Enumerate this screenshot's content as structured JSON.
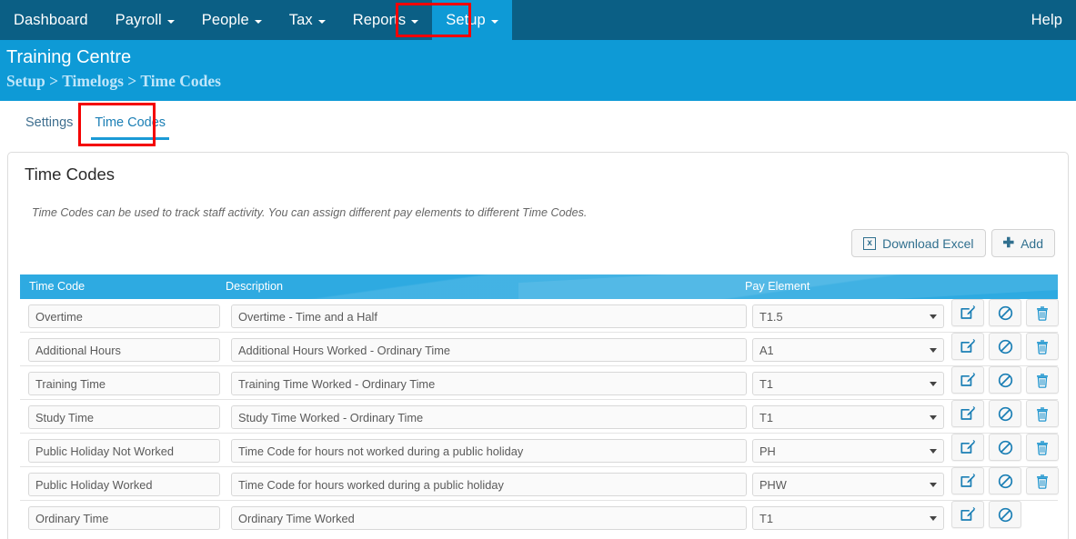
{
  "topnav": {
    "items": [
      {
        "label": "Dashboard",
        "caret": false,
        "active": false
      },
      {
        "label": "Payroll",
        "caret": true,
        "active": false
      },
      {
        "label": "People",
        "caret": true,
        "active": false
      },
      {
        "label": "Tax",
        "caret": true,
        "active": false
      },
      {
        "label": "Reports",
        "caret": true,
        "active": false
      },
      {
        "label": "Setup",
        "caret": true,
        "active": true
      }
    ],
    "help_label": "Help",
    "bg_color": "#0b5f85",
    "active_color": "#0e9ad6"
  },
  "page_header": {
    "org_title": "Training Centre",
    "breadcrumb": "Setup > Timelogs > Time Codes",
    "bg_color": "#0e9ad6"
  },
  "tabs": [
    {
      "label": "Settings",
      "active": false
    },
    {
      "label": "Time Codes",
      "active": true
    }
  ],
  "card": {
    "title": "Time Codes",
    "description": "Time Codes can be used to track staff activity. You can assign different pay elements to different Time Codes."
  },
  "toolbar": {
    "download_excel_label": "Download Excel",
    "download_excel_icon": "excel-file-icon",
    "download_excel_glyph": "x",
    "add_label": "Add",
    "add_icon": "plus-icon",
    "add_glyph": "✚"
  },
  "table": {
    "header_bg": "#2eaae1",
    "columns": [
      "Time Code",
      "Description",
      "Pay Element"
    ],
    "rows": [
      {
        "time_code": "Overtime",
        "description": "Overtime - Time and a Half",
        "pay_element": "T1.5",
        "actions": [
          "edit-icon",
          "disable-icon",
          "delete-icon"
        ]
      },
      {
        "time_code": "Additional Hours",
        "description": "Additional Hours Worked - Ordinary Time",
        "pay_element": "A1",
        "actions": [
          "edit-icon",
          "disable-icon",
          "delete-icon"
        ]
      },
      {
        "time_code": "Training Time",
        "description": "Training Time Worked - Ordinary Time",
        "pay_element": "T1",
        "actions": [
          "edit-icon",
          "disable-icon",
          "delete-icon"
        ]
      },
      {
        "time_code": "Study Time",
        "description": "Study Time Worked - Ordinary Time",
        "pay_element": "T1",
        "actions": [
          "edit-icon",
          "disable-icon",
          "delete-icon"
        ]
      },
      {
        "time_code": "Public Holiday Not Worked",
        "description": "Time Code for hours not worked during a public holiday",
        "pay_element": "PH",
        "actions": [
          "edit-icon",
          "disable-icon",
          "delete-icon"
        ]
      },
      {
        "time_code": "Public Holiday Worked",
        "description": "Time Code for hours worked during a public holiday",
        "pay_element": "PHW",
        "actions": [
          "edit-icon",
          "disable-icon",
          "delete-icon"
        ]
      },
      {
        "time_code": "Ordinary Time",
        "description": "Ordinary Time Worked",
        "pay_element": "T1",
        "actions": [
          "edit-icon",
          "disable-icon"
        ]
      }
    ]
  },
  "annotations": [
    {
      "target": "setup-nav-item",
      "color": "#f40000"
    },
    {
      "target": "tab-time-codes",
      "color": "#f40000"
    }
  ]
}
